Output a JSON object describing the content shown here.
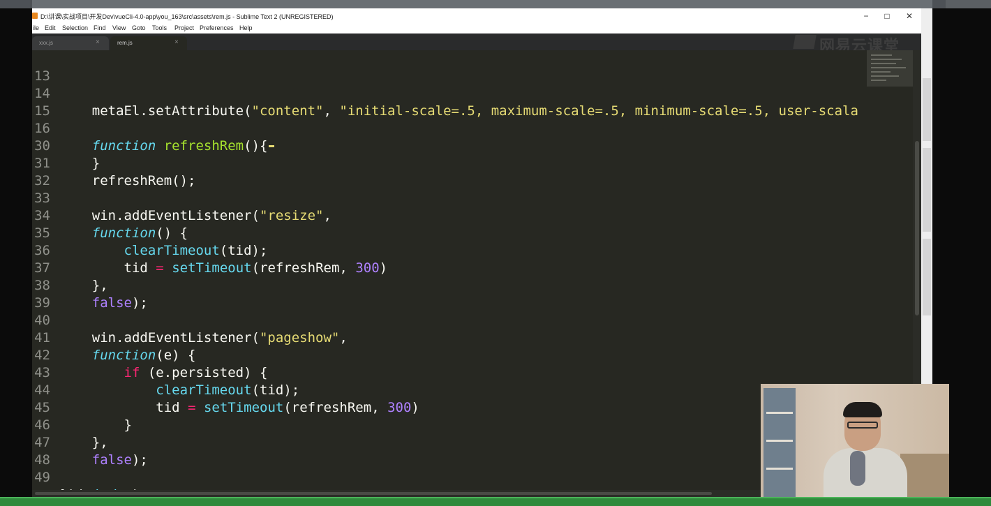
{
  "window": {
    "title": "D:\\讲课\\实战项目\\开发Dev\\vueCli-4.0-app\\you_163\\src\\assets\\rem.js - Sublime Text 2 (UNREGISTERED)",
    "controls": {
      "minimize": "−",
      "maximize": "□",
      "close": "✕"
    }
  },
  "menu": [
    "ile",
    "Edit",
    "Selection",
    "Find",
    "View",
    "Goto",
    "Tools",
    "Project",
    "Preferences",
    "Help"
  ],
  "tabs": [
    {
      "label": "xxx.js",
      "close": "×"
    },
    {
      "label": "rem.js",
      "close": "×"
    }
  ],
  "watermark": "网易云课堂",
  "code": {
    "line_numbers": [
      "13",
      "14",
      "15",
      "16",
      "30",
      "31",
      "32",
      "33",
      "34",
      "35",
      "36",
      "37",
      "38",
      "39",
      "40",
      "41",
      "42",
      "43",
      "44",
      "45",
      "46",
      "47",
      "48",
      "49"
    ],
    "lines": [
      {
        "indent": ""
      },
      {
        "a": "    metaEl.setAttribute(",
        "s1": "\"content\"",
        "b": ", ",
        "s2": "\"initial-scale=.5, maximum-scale=.5, minimum-scale=.5, user-scala"
      },
      {
        "indent": ""
      },
      {
        "kw": "function",
        "fn": "refreshRem",
        "rest": "(){"
      },
      {
        "rest": "    }"
      },
      {
        "rest": "    refreshRem();"
      },
      {
        "indent": ""
      },
      {
        "a": "    win.addEventListener(",
        "s1": "\"resize\"",
        "b": ","
      },
      {
        "kw": "function",
        "rest": "() {"
      },
      {
        "call": "clearTimeout",
        "rest": "(tid);"
      },
      {
        "var": "tid",
        "op": "=",
        "call": "setTimeout",
        "args": "(refreshRem, ",
        "num": "300",
        "end": ")"
      },
      {
        "rest": "    },"
      },
      {
        "bool": "false",
        "rest": ");"
      },
      {
        "indent": ""
      },
      {
        "a": "    win.addEventListener(",
        "s1": "\"pageshow\"",
        "b": ","
      },
      {
        "kw": "function",
        "rest": "(e) {"
      },
      {
        "ctrl": "if",
        "rest": " (e.persisted) {"
      },
      {
        "call": "clearTimeout",
        "rest": "(tid);"
      },
      {
        "var": "tid",
        "op": "=",
        "call": "setTimeout",
        "args": "(refreshRem, ",
        "num": "300",
        "end": ")"
      },
      {
        "rest": "        }"
      },
      {
        "rest": "    },"
      },
      {
        "bool": "false",
        "rest": ");"
      },
      {
        "indent": ""
      },
      {
        "a": "})(",
        "kw": "window",
        "rest": ")"
      }
    ]
  },
  "colors": {
    "editor_bg": "#272822",
    "keyword": "#66d9ef",
    "function": "#a6e22e",
    "string": "#e6db74",
    "number": "#ae81ff",
    "operator": "#f92672",
    "status_bar": "#2f8a3c"
  }
}
